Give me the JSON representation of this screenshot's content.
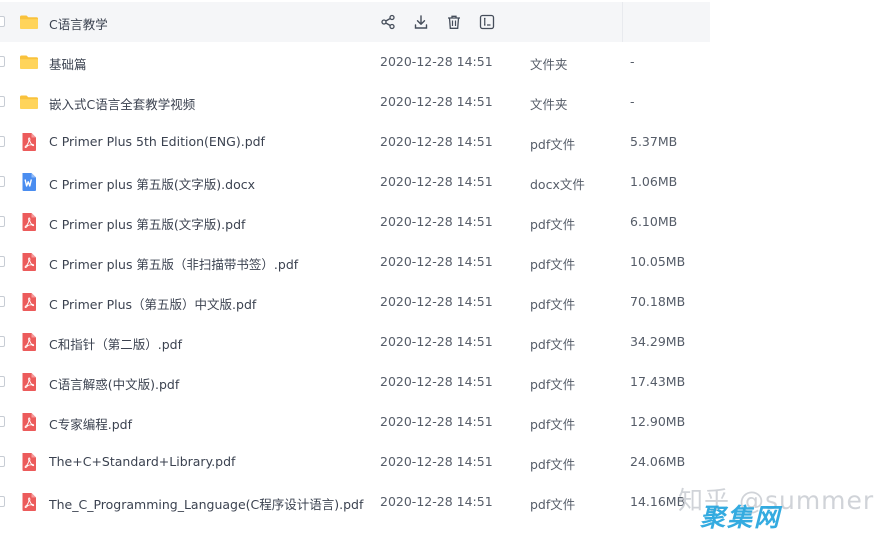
{
  "files": [
    {
      "name": "C语言教学",
      "date": "",
      "type": "",
      "size": "",
      "kind": "folder",
      "hover": true
    },
    {
      "name": "基础篇",
      "date": "2020-12-28 14:51",
      "type": "文件夹",
      "size": "-",
      "kind": "folder"
    },
    {
      "name": "嵌入式C语言全套教学视频",
      "date": "2020-12-28 14:51",
      "type": "文件夹",
      "size": "-",
      "kind": "folder"
    },
    {
      "name": "C Primer Plus 5th Edition(ENG).pdf",
      "date": "2020-12-28 14:51",
      "type": "pdf文件",
      "size": "5.37MB",
      "kind": "pdf"
    },
    {
      "name": "C Primer plus 第五版(文字版).docx",
      "date": "2020-12-28 14:51",
      "type": "docx文件",
      "size": "1.06MB",
      "kind": "docx"
    },
    {
      "name": "C Primer plus 第五版(文字版).pdf",
      "date": "2020-12-28 14:51",
      "type": "pdf文件",
      "size": "6.10MB",
      "kind": "pdf"
    },
    {
      "name": "C Primer plus 第五版（非扫描带书签）.pdf",
      "date": "2020-12-28 14:51",
      "type": "pdf文件",
      "size": "10.05MB",
      "kind": "pdf"
    },
    {
      "name": "C Primer Plus（第五版）中文版.pdf",
      "date": "2020-12-28 14:51",
      "type": "pdf文件",
      "size": "70.18MB",
      "kind": "pdf"
    },
    {
      "name": "C和指针（第二版）.pdf",
      "date": "2020-12-28 14:51",
      "type": "pdf文件",
      "size": "34.29MB",
      "kind": "pdf"
    },
    {
      "name": "C语言解惑(中文版).pdf",
      "date": "2020-12-28 14:51",
      "type": "pdf文件",
      "size": "17.43MB",
      "kind": "pdf"
    },
    {
      "name": "C专家编程.pdf",
      "date": "2020-12-28 14:51",
      "type": "pdf文件",
      "size": "12.90MB",
      "kind": "pdf"
    },
    {
      "name": "The+C+Standard+Library.pdf",
      "date": "2020-12-28 14:51",
      "type": "pdf文件",
      "size": "24.06MB",
      "kind": "pdf"
    },
    {
      "name": "The_C_Programming_Language(C程序设计语言).pdf",
      "date": "2020-12-28 14:51",
      "type": "pdf文件",
      "size": "14.16MB",
      "kind": "pdf"
    }
  ],
  "row_actions": [
    "share-icon",
    "download-icon",
    "delete-icon",
    "rename-icon"
  ],
  "watermark": {
    "top": "知乎 @summer",
    "bottom": "聚集网"
  },
  "colors": {
    "folder": "#f9c23c",
    "pdf": "#ec5b5b",
    "docx": "#4a8df0",
    "hover_bg": "#f5f6f8",
    "watermark_blue": "#1fa3dd"
  }
}
